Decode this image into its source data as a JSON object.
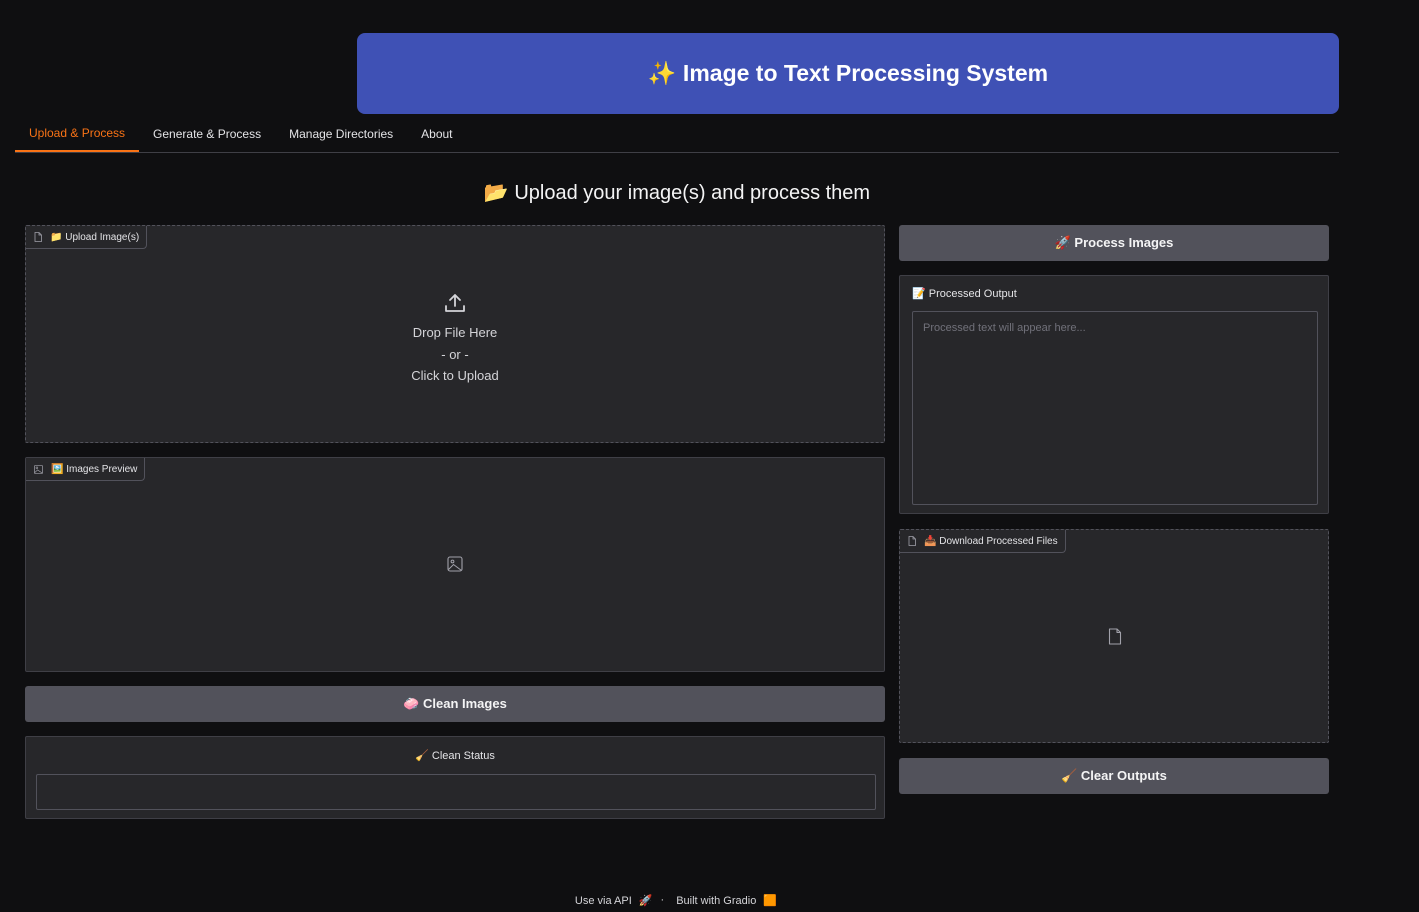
{
  "header": {
    "title": "✨ Image to Text Processing System"
  },
  "tabs": [
    {
      "label": "Upload & Process",
      "active": true
    },
    {
      "label": "Generate & Process",
      "active": false
    },
    {
      "label": "Manage Directories",
      "active": false
    },
    {
      "label": "About",
      "active": false
    }
  ],
  "section": {
    "title": "📂 Upload your image(s) and process them"
  },
  "upload": {
    "label": "📁 Upload Image(s)",
    "drop_text": "Drop File Here",
    "or_text": "- or -",
    "click_text": "Click to Upload"
  },
  "preview": {
    "label": "🖼️ Images Preview"
  },
  "clean_button": {
    "label": "🧼 Clean Images"
  },
  "clean_status": {
    "label": "🧹 Clean Status",
    "value": ""
  },
  "process_button": {
    "label": "🚀 Process Images"
  },
  "output": {
    "label": "📝 Processed Output",
    "placeholder": "Processed text will appear here..."
  },
  "download": {
    "label": "📥 Download Processed Files"
  },
  "clear_button": {
    "label": "🧹 Clear Outputs"
  },
  "footer": {
    "api_link": "Use via API",
    "separator": "·",
    "built_with": "Built with Gradio"
  },
  "colors": {
    "background": "#0f0f11",
    "banner": "#3f51b5",
    "active_tab": "#f97316",
    "panel": "#27272a",
    "button": "#52525b"
  }
}
